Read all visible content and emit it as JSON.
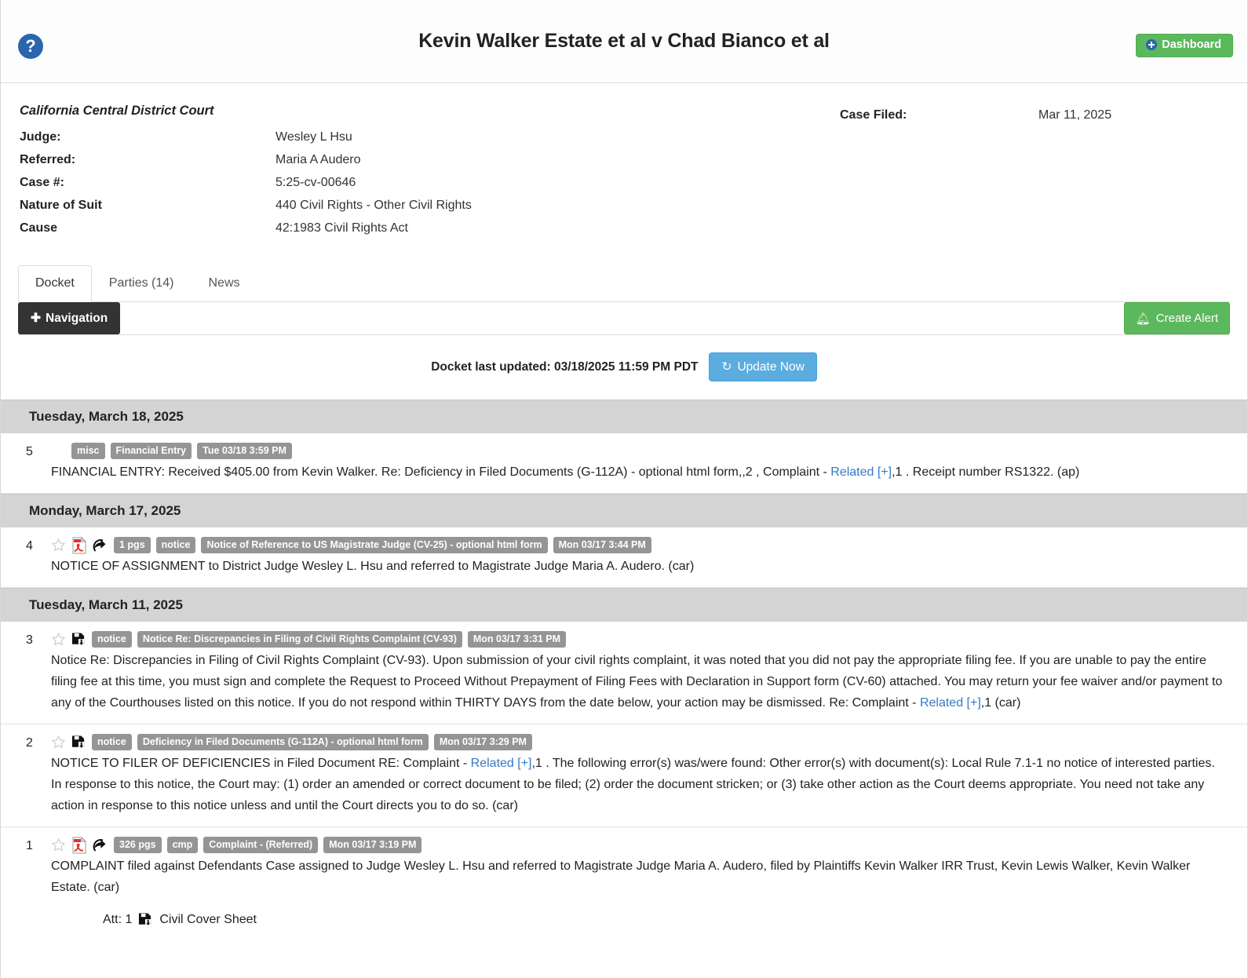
{
  "header": {
    "help_icon": "help-circle-icon",
    "case_title": "Kevin Walker Estate et al v Chad Bianco et al",
    "dashboard_label": "Dashboard",
    "dashboard_bg": "#5cb85c",
    "dashboard_icon": "circle-plus-icon"
  },
  "meta": {
    "court": "California Central District Court",
    "rows": [
      {
        "label": "Judge:",
        "value": "Wesley L Hsu"
      },
      {
        "label": "Referred:",
        "value": "Maria A Audero"
      },
      {
        "label": "Case #:",
        "value": "5:25-cv-00646"
      },
      {
        "label": "Nature of Suit",
        "value": "440 Civil Rights - Other Civil Rights"
      },
      {
        "label": "Cause",
        "value": "42:1983 Civil Rights Act"
      }
    ],
    "filed_label": "Case Filed:",
    "filed_value": "Mar 11, 2025"
  },
  "tabs": [
    {
      "label": "Docket",
      "active": true
    },
    {
      "label": "Parties (14)",
      "active": false
    },
    {
      "label": "News",
      "active": false
    }
  ],
  "toolbar": {
    "navigation_label": "Navigation",
    "navigation_icon": "plus-icon",
    "create_alert_label": "Create Alert",
    "create_alert_icon": "bell-icon",
    "create_alert_bg": "#5cb85c"
  },
  "update": {
    "text": "Docket last updated: 03/18/2025 11:59 PM PDT",
    "button_label": "Update Now",
    "button_icon": "refresh-icon",
    "button_bg": "#5bacdf"
  },
  "docket": {
    "groups": [
      {
        "date": "Tuesday, March 18, 2025",
        "entries": [
          {
            "number": "5",
            "icons": [],
            "badges": [
              "misc",
              "Financial Entry",
              "Tue 03/18 3:59 PM"
            ],
            "text_parts": [
              {
                "t": "FINANCIAL ENTRY: Received $405.00 from Kevin Walker. Re: Deficiency in Filed Documents (G-112A) - optional html form,,2 , Complaint - "
              },
              {
                "t": "Related [+]",
                "link": true
              },
              {
                "t": ",1 . Receipt number RS1322. (ap)"
              }
            ],
            "attachment": null
          }
        ]
      },
      {
        "date": "Monday, March 17, 2025",
        "entries": [
          {
            "number": "4",
            "icons": [
              "star-icon",
              "pdf-icon",
              "share-icon"
            ],
            "badges": [
              "1 pgs",
              "notice",
              "Notice of Reference to US Magistrate Judge (CV-25) - optional html form",
              "Mon 03/17 3:44 PM"
            ],
            "text_parts": [
              {
                "t": "NOTICE OF ASSIGNMENT to District Judge Wesley L. Hsu and referred to Magistrate Judge Maria A. Audero. (car)"
              }
            ],
            "attachment": null
          }
        ]
      },
      {
        "date": "Tuesday, March 11, 2025",
        "entries": [
          {
            "number": "3",
            "icons": [
              "star-icon",
              "save-icon"
            ],
            "badges": [
              "notice",
              "Notice Re: Discrepancies in Filing of Civil Rights Complaint (CV-93)",
              "Mon 03/17 3:31 PM"
            ],
            "text_parts": [
              {
                "t": "Notice Re: Discrepancies in Filing of Civil Rights Complaint (CV-93). Upon submission of your civil rights complaint, it was noted that you did not pay the appropriate filing fee. If you are unable to pay the entire filing fee at this time, you must sign and complete the Request to Proceed Without Prepayment of Filing Fees with Declaration in Support form (CV-60) attached. You may return your fee waiver and/or payment to any of the Courthouses listed on this notice. If you do not respond within THIRTY DAYS from the date below, your action may be dismissed. Re: Complaint - "
              },
              {
                "t": "Related [+]",
                "link": true
              },
              {
                "t": ",1 (car)"
              }
            ],
            "attachment": null
          },
          {
            "number": "2",
            "icons": [
              "star-icon",
              "save-icon"
            ],
            "badges": [
              "notice",
              "Deficiency in Filed Documents (G-112A) - optional html form",
              "Mon 03/17 3:29 PM"
            ],
            "text_parts": [
              {
                "t": "NOTICE TO FILER OF DEFICIENCIES in Filed Document RE: Complaint - "
              },
              {
                "t": "Related [+]",
                "link": true
              },
              {
                "t": ",1 . The following error(s) was/were found: Other error(s) with document(s): Local Rule 7.1-1 no notice of interested parties. In response to this notice, the Court may: (1) order an amended or correct document to be filed; (2) order the document stricken; or (3) take other action as the Court deems appropriate. You need not take any action in response to this notice unless and until the Court directs you to do so. (car)"
              }
            ],
            "attachment": null
          },
          {
            "number": "1",
            "icons": [
              "star-icon",
              "pdf-icon",
              "share-icon"
            ],
            "badges": [
              "326 pgs",
              "cmp",
              "Complaint - (Referred)",
              "Mon 03/17 3:19 PM"
            ],
            "text_parts": [
              {
                "t": "COMPLAINT filed against Defendants Case assigned to Judge Wesley L. Hsu and referred to Magistrate Judge Maria A. Audero, filed by Plaintiffs Kevin Walker IRR Trust, Kevin Lewis Walker, Kevin Walker Estate. (car)"
              }
            ],
            "attachment": {
              "prefix": "Att: 1",
              "icon": "save-icon",
              "label": "Civil Cover Sheet"
            }
          }
        ]
      }
    ]
  }
}
